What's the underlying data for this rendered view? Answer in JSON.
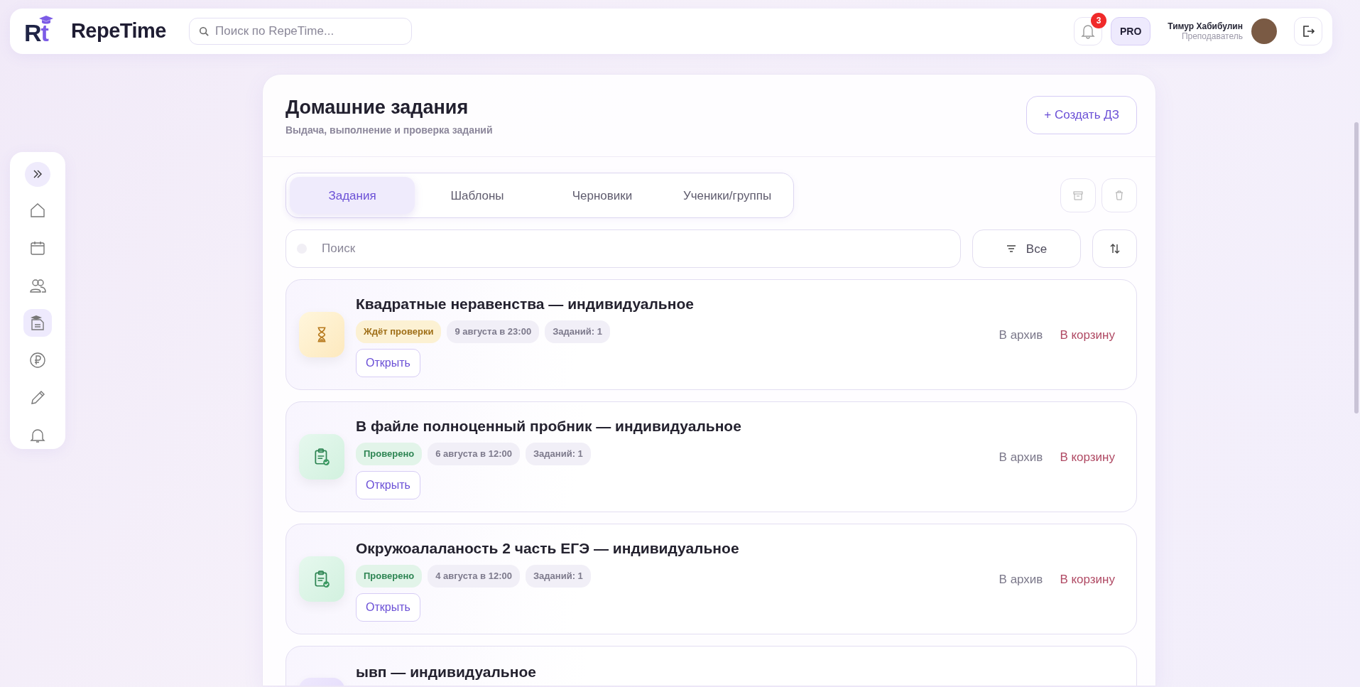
{
  "header": {
    "logo_mark": "Rt",
    "brand": "RepeTime",
    "search": {
      "placeholder": "Поиск по RepeTime..."
    },
    "notifications": {
      "count": "3"
    },
    "plan_badge": "PRO",
    "user": {
      "name": "Тимур Хабибулин",
      "role": "Преподаватель"
    }
  },
  "sidebar": {
    "items": [
      {
        "kind": "home",
        "selected": false
      },
      {
        "kind": "calendar",
        "selected": false
      },
      {
        "kind": "people",
        "selected": false
      },
      {
        "kind": "homework",
        "selected": true
      },
      {
        "kind": "ruble",
        "selected": false
      },
      {
        "kind": "pencil",
        "selected": false
      },
      {
        "kind": "bell",
        "selected": false
      }
    ]
  },
  "page": {
    "title": "Домашние задания",
    "subtitle": "Выдача, выполнение и проверка заданий",
    "create_button": "+ Создать ДЗ"
  },
  "tabs": [
    {
      "label": "Задания",
      "selected": true
    },
    {
      "label": "Шаблоны",
      "selected": false
    },
    {
      "label": "Черновики",
      "selected": false
    },
    {
      "label": "Ученики/группы",
      "selected": false
    }
  ],
  "search": {
    "placeholder": "Поиск"
  },
  "filter": {
    "label": "Все"
  },
  "assignments": [
    {
      "title": "Квадратные неравенства — индивидуальное",
      "kind": "pending",
      "status": "Ждёт проверки",
      "due": "9 августа в 23:00",
      "count": "Заданий: 1",
      "open": "Открыть",
      "archive": "В архив",
      "trash": "В корзину"
    },
    {
      "title": "В файле полноценный пробник — индивидуальное",
      "kind": "checked",
      "status": "Проверено",
      "due": "6 августа в 12:00",
      "count": "Заданий: 1",
      "open": "Открыть",
      "archive": "В архив",
      "trash": "В корзину"
    },
    {
      "title": "Окружоалаланость 2 часть ЕГЭ — индивидуальное",
      "kind": "checked",
      "status": "Проверено",
      "due": "4 августа в 12:00",
      "count": "Заданий: 1",
      "open": "Открыть",
      "archive": "В архив",
      "trash": "В корзину"
    },
    {
      "title": "ывп — индивидуальное",
      "kind": "group"
    }
  ]
}
